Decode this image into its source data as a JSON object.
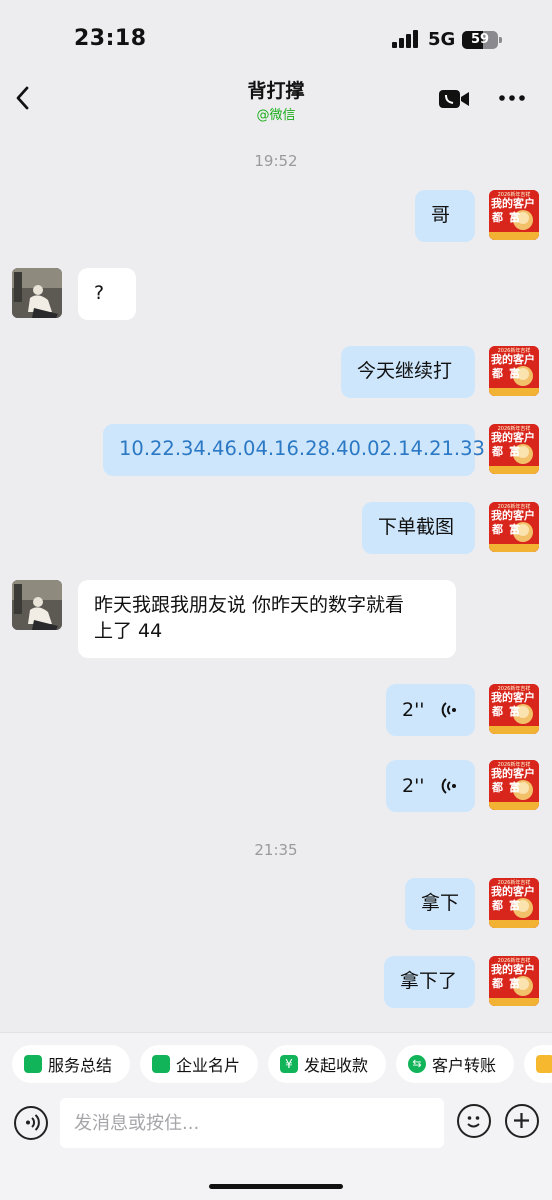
{
  "status_bar": {
    "time": "23:18",
    "network": "5G",
    "battery": "59",
    "battery_level": 0.59
  },
  "header": {
    "title": "背打撑",
    "subtitle": "@微信"
  },
  "messages": [
    {
      "type": "time",
      "text": "19:52"
    },
    {
      "type": "text",
      "from": "me",
      "text": "哥"
    },
    {
      "type": "text",
      "from": "them",
      "text": "?"
    },
    {
      "type": "text",
      "from": "me",
      "text": "今天继续打"
    },
    {
      "type": "link",
      "from": "me",
      "text": "10.22.34.46.04.16.28.40.02.14.21.33"
    },
    {
      "type": "text",
      "from": "me",
      "text": "下单截图"
    },
    {
      "type": "text",
      "from": "them",
      "line1": "昨天我跟我朋友说 你昨天的数字就看",
      "line2": "上了 44"
    },
    {
      "type": "voice",
      "from": "me",
      "text": "2''"
    },
    {
      "type": "voice",
      "from": "me",
      "text": "2''"
    },
    {
      "type": "time",
      "text": "21:35"
    },
    {
      "type": "text",
      "from": "me",
      "text": "拿下"
    },
    {
      "type": "text",
      "from": "me",
      "text": "拿下了"
    }
  ],
  "my_avatar": {
    "banner": "2026新年吉祥",
    "line1": "我的客户",
    "line2": "都富"
  },
  "quick_actions": [
    {
      "label": "服务总结",
      "icon": "service-summary-icon",
      "color": "#12b45a"
    },
    {
      "label": "企业名片",
      "icon": "business-card-icon",
      "color": "#12b45a"
    },
    {
      "label": "发起收款",
      "icon": "payment-icon",
      "color": "#12b45a"
    },
    {
      "label": "客户转账",
      "icon": "transfer-icon",
      "color": "#12b45a"
    },
    {
      "label": "",
      "icon": "more-action-icon",
      "color": "#f5b82e"
    }
  ],
  "composer": {
    "placeholder": "发消息或按住..."
  }
}
